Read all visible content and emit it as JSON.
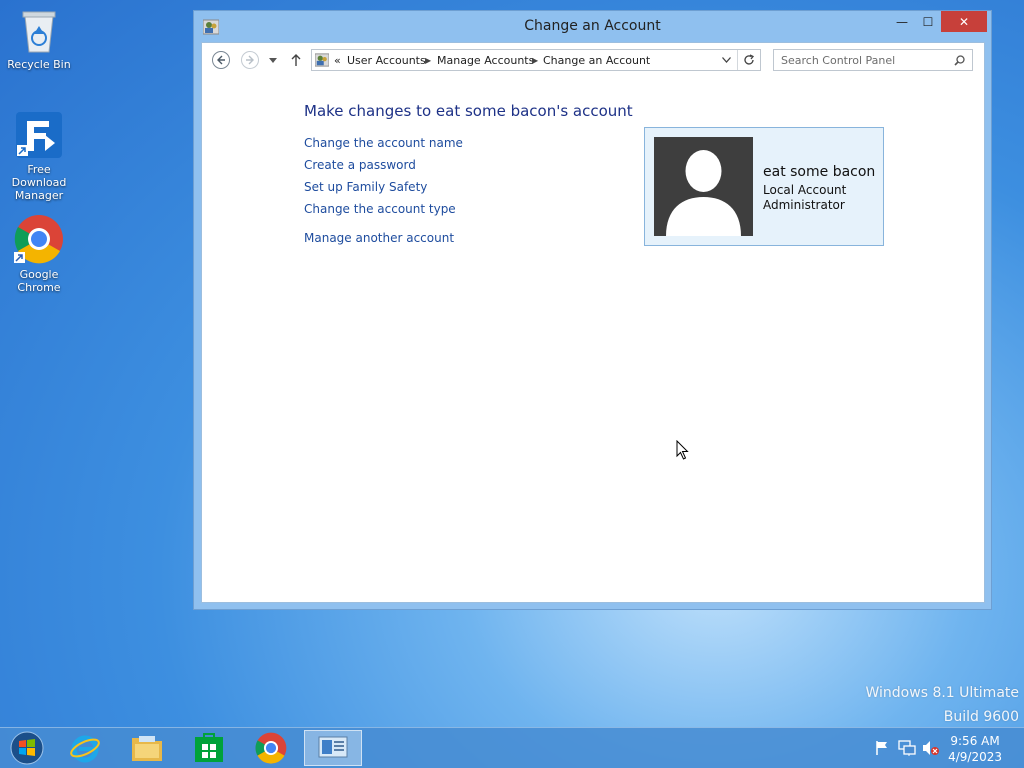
{
  "desktop": {
    "icons": [
      {
        "label": "Recycle Bin"
      },
      {
        "label": "Free Download Manager"
      },
      {
        "label": "Google Chrome"
      }
    ],
    "watermark": {
      "line1": "Windows 8.1 Ultimate",
      "line2": "Build 9600"
    }
  },
  "window": {
    "title": "Change an Account",
    "controls": {
      "minimize": "—",
      "maximize": "☐",
      "close": "✕"
    },
    "address": {
      "overflow": "«",
      "crumbs": [
        "User Accounts",
        "Manage Accounts",
        "Change an Account"
      ]
    },
    "search": {
      "placeholder": "Search Control Panel"
    },
    "heading": "Make changes to eat some bacon's account",
    "links": [
      "Change the account name",
      "Create a password",
      "Set up Family Safety",
      "Change the account type",
      "Manage another account"
    ],
    "account": {
      "name": "eat some bacon",
      "type": "Local Account",
      "role": "Administrator"
    }
  },
  "taskbar": {
    "clock": {
      "time": "9:56 AM",
      "date": "4/9/2023"
    }
  },
  "colors": {
    "link": "#1e4c9e",
    "heading": "#1e3287",
    "close": "#c7403a",
    "card": "#e6f2fb"
  }
}
